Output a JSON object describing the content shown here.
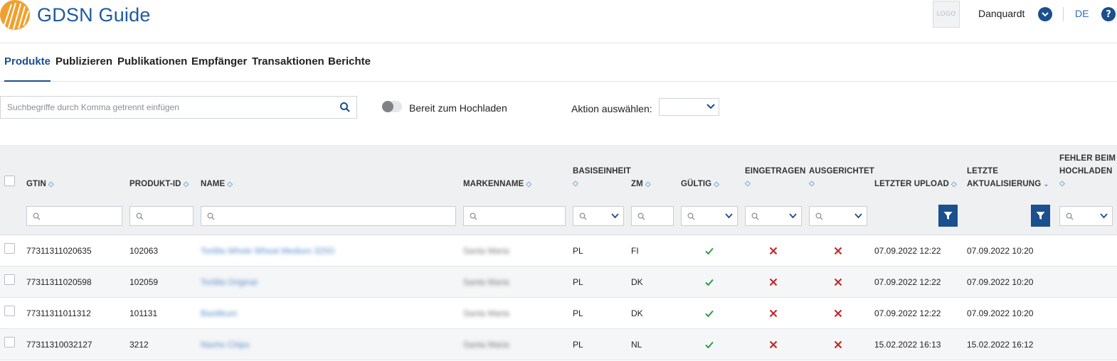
{
  "app": {
    "title": "GDSN Guide",
    "logo_placeholder": "LOGO",
    "user": "Danquardt",
    "language": "DE",
    "help": "?"
  },
  "nav": {
    "tabs": [
      {
        "label": "Produkte",
        "active": true
      },
      {
        "label": "Publizieren",
        "active": false
      },
      {
        "label": "Publikationen",
        "active": false
      },
      {
        "label": "Empfänger",
        "active": false
      },
      {
        "label": "Transaktionen",
        "active": false
      },
      {
        "label": "Berichte",
        "active": false
      }
    ]
  },
  "toolbar": {
    "search_placeholder": "Suchbegriffe durch Komma getrennt einfügen",
    "search_value": "",
    "toggle_label": "Bereit zum Hochladen",
    "toggle_on": false,
    "action_label": "Aktion auswählen:",
    "action_value": ""
  },
  "table": {
    "columns": {
      "gtin": "GTIN",
      "produkt_id": "PRODUKT-ID",
      "name": "NAME",
      "markenname": "MARKENNAME",
      "basiseinheit": "BASISEINHEIT",
      "zm": "ZM",
      "gueltig": "GÜLTIG",
      "eingetragen": "EINGETRAGEN",
      "ausgerichtet": "AUSGERICHTET",
      "letzter_upload": "LETZTER UPLOAD",
      "letzte_aktualisierung_1": "LETZTE",
      "letzte_aktualisierung_2": "AKTUALISIERUNG",
      "fehler_1": "FEHLER BEIM",
      "fehler_2": "HOCHLADEN"
    },
    "rows": [
      {
        "gtin": "77311311020635",
        "produkt_id": "102063",
        "name": "Tortilla Whole Wheat Medium 320G",
        "markenname": "Santa Maria",
        "basiseinheit": "PL",
        "zm": "FI",
        "gueltig": true,
        "eingetragen": false,
        "ausgerichtet": false,
        "letzter_upload": "07.09.2022 12:22",
        "letzte_aktualisierung": "07.09.2022 10:20"
      },
      {
        "gtin": "77311311020598",
        "produkt_id": "102059",
        "name": "Tortilla Original",
        "markenname": "Santa Maria",
        "basiseinheit": "PL",
        "zm": "DK",
        "gueltig": true,
        "eingetragen": false,
        "ausgerichtet": false,
        "letzter_upload": "07.09.2022 12:22",
        "letzte_aktualisierung": "07.09.2022 10:20"
      },
      {
        "gtin": "77311311011312",
        "produkt_id": "101131",
        "name": "Basilikum",
        "markenname": "Santa Maria",
        "basiseinheit": "PL",
        "zm": "DK",
        "gueltig": true,
        "eingetragen": false,
        "ausgerichtet": false,
        "letzter_upload": "07.09.2022 12:22",
        "letzte_aktualisierung": "07.09.2022 10:20"
      },
      {
        "gtin": "77311310032127",
        "produkt_id": "3212",
        "name": "Nacho Chips",
        "markenname": "Santa Maria",
        "basiseinheit": "PL",
        "zm": "NL",
        "gueltig": true,
        "eingetragen": false,
        "ausgerichtet": false,
        "letzter_upload": "15.02.2022 16:13",
        "letzte_aktualisierung": "15.02.2022 16:12"
      }
    ]
  },
  "colors": {
    "brand": "#1b4f8e",
    "link": "#2a6ebb",
    "valid": "#2e9b47",
    "invalid": "#c62828",
    "header_bg": "#eef0f2",
    "accent_orange": "#f0a030"
  }
}
